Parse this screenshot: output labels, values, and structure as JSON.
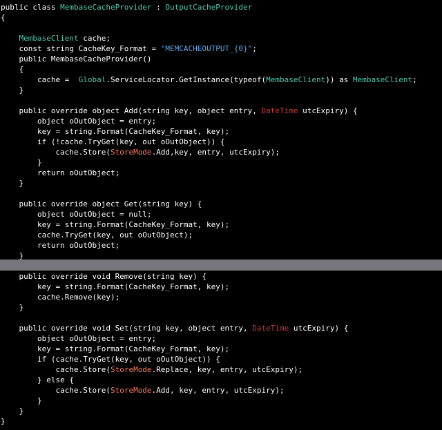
{
  "editor": {
    "theme": {
      "background": "#000000",
      "plain": "#ffffff",
      "type": "#4ec9b0",
      "struct": "#cc3a3a",
      "string": "#5aa7e8",
      "enum": "#ff7a5c",
      "highlight": "#76767c"
    },
    "highlighted_line_index": 24,
    "lines": [
      {
        "tokens": [
          {
            "t": "public class ",
            "c": "kw"
          },
          {
            "t": "MembaseCacheProvider",
            "c": "type"
          },
          {
            "t": " : ",
            "c": "plain"
          },
          {
            "t": "OutputCacheProvider",
            "c": "type"
          }
        ]
      },
      {
        "tokens": [
          {
            "t": "{",
            "c": "plain"
          }
        ]
      },
      {
        "tokens": []
      },
      {
        "tokens": [
          {
            "t": "    ",
            "c": "plain"
          },
          {
            "t": "MembaseClient",
            "c": "type"
          },
          {
            "t": " cache;",
            "c": "plain"
          }
        ]
      },
      {
        "tokens": [
          {
            "t": "    const string CacheKey_Format = ",
            "c": "plain"
          },
          {
            "t": "\"MEMCACHEOUTPUT_{0}\"",
            "c": "string"
          },
          {
            "t": ";",
            "c": "plain"
          }
        ]
      },
      {
        "tokens": [
          {
            "t": "    public MembaseCacheProvider()",
            "c": "plain"
          }
        ]
      },
      {
        "tokens": [
          {
            "t": "    {",
            "c": "plain"
          }
        ]
      },
      {
        "tokens": [
          {
            "t": "        cache =  ",
            "c": "plain"
          },
          {
            "t": "Global",
            "c": "type"
          },
          {
            "t": ".ServiceLocator.GetInstance(typeof(",
            "c": "plain"
          },
          {
            "t": "MembaseClient",
            "c": "type"
          },
          {
            "t": ")) as ",
            "c": "plain"
          },
          {
            "t": "MembaseClient",
            "c": "type"
          },
          {
            "t": ";",
            "c": "plain"
          }
        ]
      },
      {
        "tokens": [
          {
            "t": "    }",
            "c": "plain"
          }
        ]
      },
      {
        "tokens": []
      },
      {
        "tokens": [
          {
            "t": "    public override object Add(string key, object entry, ",
            "c": "plain"
          },
          {
            "t": "DateTime",
            "c": "struct"
          },
          {
            "t": " utcExpiry) {",
            "c": "plain"
          }
        ]
      },
      {
        "tokens": [
          {
            "t": "        object oOutObject = entry;",
            "c": "plain"
          }
        ]
      },
      {
        "tokens": [
          {
            "t": "        key = string.Format(CacheKey_Format, key);",
            "c": "plain"
          }
        ]
      },
      {
        "tokens": [
          {
            "t": "        if (!cache.TryGet(key, out oOutObject)) {",
            "c": "plain"
          }
        ]
      },
      {
        "tokens": [
          {
            "t": "            cache.Store(",
            "c": "plain"
          },
          {
            "t": "StoreMode",
            "c": "enum"
          },
          {
            "t": ".Add,key, entry, utcExpiry);",
            "c": "plain"
          }
        ]
      },
      {
        "tokens": [
          {
            "t": "        }",
            "c": "plain"
          }
        ]
      },
      {
        "tokens": [
          {
            "t": "        return oOutObject;",
            "c": "plain"
          }
        ]
      },
      {
        "tokens": [
          {
            "t": "    }",
            "c": "plain"
          }
        ]
      },
      {
        "tokens": []
      },
      {
        "tokens": [
          {
            "t": "    public override object Get(string key) {",
            "c": "plain"
          }
        ]
      },
      {
        "tokens": [
          {
            "t": "        object oOutObject = null;",
            "c": "plain"
          }
        ]
      },
      {
        "tokens": [
          {
            "t": "        key = string.Format(CacheKey_Format, key);",
            "c": "plain"
          }
        ]
      },
      {
        "tokens": [
          {
            "t": "        cache.TryGet(key, out oOutObject);",
            "c": "plain"
          }
        ]
      },
      {
        "tokens": [
          {
            "t": "        return oOutObject;",
            "c": "plain"
          }
        ]
      },
      {
        "tokens": [
          {
            "t": "    }",
            "c": "plain"
          }
        ]
      },
      {
        "tokens": []
      },
      {
        "tokens": [
          {
            "t": "    public override void Remove(string key) {",
            "c": "plain"
          }
        ]
      },
      {
        "tokens": [
          {
            "t": "        key = string.Format(CacheKey_Format, key);",
            "c": "plain"
          }
        ]
      },
      {
        "tokens": [
          {
            "t": "        cache.Remove(key);",
            "c": "plain"
          }
        ]
      },
      {
        "tokens": [
          {
            "t": "    }",
            "c": "plain"
          }
        ]
      },
      {
        "tokens": []
      },
      {
        "tokens": [
          {
            "t": "    public override void Set(string key, object entry, ",
            "c": "plain"
          },
          {
            "t": "DateTime",
            "c": "struct"
          },
          {
            "t": " utcExpiry) {",
            "c": "plain"
          }
        ]
      },
      {
        "tokens": [
          {
            "t": "        object oOutObject = entry;",
            "c": "plain"
          }
        ]
      },
      {
        "tokens": [
          {
            "t": "        key = string.Format(CacheKey_Format, key);",
            "c": "plain"
          }
        ]
      },
      {
        "tokens": [
          {
            "t": "        if (cache.TryGet(key, out oOutObject)) {",
            "c": "plain"
          }
        ]
      },
      {
        "tokens": [
          {
            "t": "            cache.Store(",
            "c": "plain"
          },
          {
            "t": "StoreMode",
            "c": "enum"
          },
          {
            "t": ".Replace, key, entry, utcExpiry);",
            "c": "plain"
          }
        ]
      },
      {
        "tokens": [
          {
            "t": "        } else {",
            "c": "plain"
          }
        ]
      },
      {
        "tokens": [
          {
            "t": "            cache.Store(",
            "c": "plain"
          },
          {
            "t": "StoreMode",
            "c": "enum"
          },
          {
            "t": ".Add, key, entry, utcExpiry);",
            "c": "plain"
          }
        ]
      },
      {
        "tokens": [
          {
            "t": "        }",
            "c": "plain"
          }
        ]
      },
      {
        "tokens": [
          {
            "t": "    }",
            "c": "plain"
          }
        ]
      },
      {
        "tokens": [
          {
            "t": "}",
            "c": "plain"
          }
        ]
      }
    ]
  }
}
